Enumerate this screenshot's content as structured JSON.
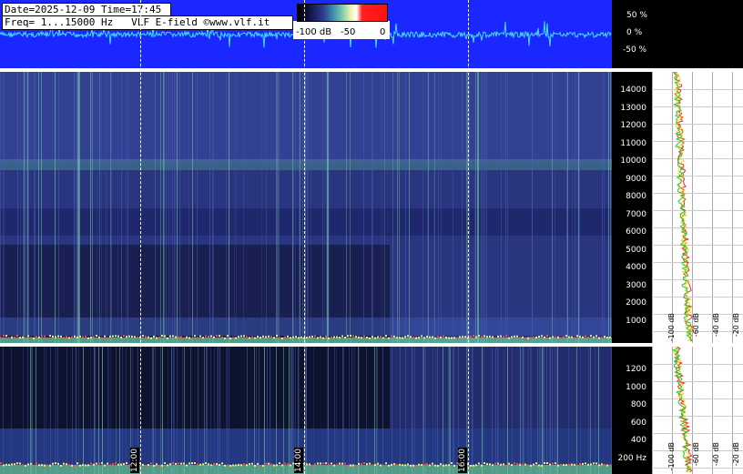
{
  "header": {
    "line1": "Date=2025-12-09 Time=17:45",
    "line2": "Freq= 1...15000 Hz   VLF E-field ©www.vlf.it"
  },
  "colorbar": {
    "labels": [
      "-100 dB",
      "-50",
      "0"
    ]
  },
  "waveform_scale": [
    "50 %",
    "0 %",
    "-50 %"
  ],
  "spectrogram_full": {
    "freq_labels": [
      "14000",
      "13000",
      "12000",
      "11000",
      "10000",
      "9000",
      "8000",
      "7000",
      "6000",
      "5000",
      "4000",
      "3000",
      "2000",
      "1000"
    ]
  },
  "spectrogram_zoom": {
    "freq_labels": [
      "1200",
      "1000",
      "800",
      "600",
      "400",
      "200 Hz"
    ]
  },
  "time_labels": [
    "12:00",
    "14:00",
    "16:00"
  ],
  "spectrum_top": {
    "db_labels": [
      "-100 dB",
      "-60 dB",
      "-40 dB",
      "-20 dB"
    ]
  },
  "spectrum_bottom": {
    "db_labels": [
      "-100 dB",
      "-60 dB",
      "-40 dB",
      "-20 dB"
    ]
  },
  "colors": {
    "wave_bg": "#1a28ff",
    "wave_trace": "#40e0ff",
    "spec_dark": "#0e1230",
    "spec_mid": "#2a3580"
  }
}
